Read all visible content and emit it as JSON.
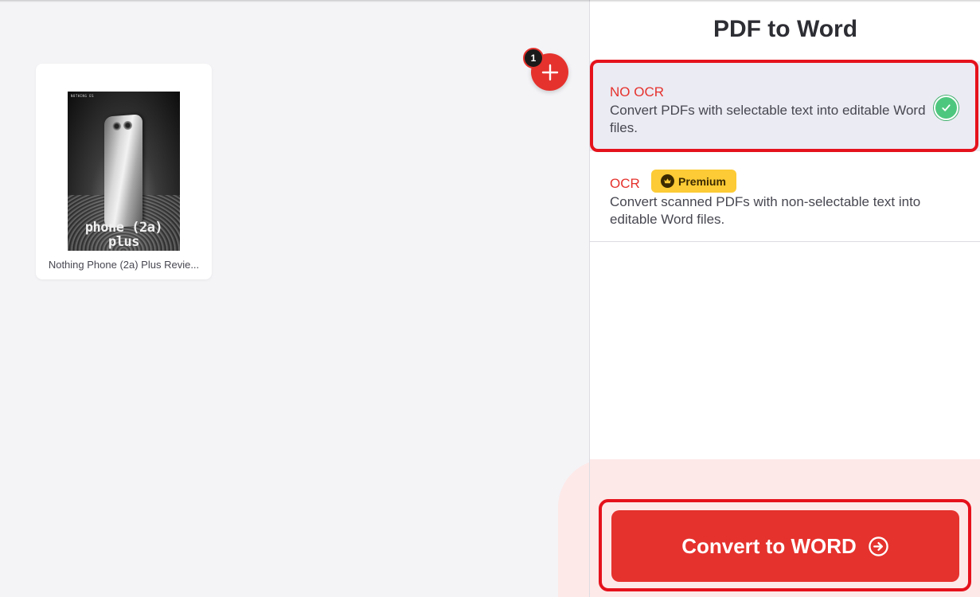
{
  "workspace": {
    "files": [
      {
        "name": "Nothing Phone (2a) Plus Revie...",
        "thumbnail_caption": "phone (2a) plus",
        "thumbnail_header": "NOTHING ES"
      }
    ],
    "file_count": "1",
    "add_icon": "plus-icon"
  },
  "sidebar": {
    "title": "PDF to Word",
    "options": [
      {
        "id": "no-ocr",
        "title": "NO OCR",
        "description": "Convert PDFs with selectable text into editable Word files.",
        "selected": true,
        "icon": "check-icon"
      },
      {
        "id": "ocr",
        "title": "OCR",
        "badge": "Premium",
        "badge_icon": "crown-icon",
        "description": "Convert scanned PDFs with non-selectable text into editable Word files.",
        "selected": false
      }
    ],
    "action": {
      "label": "Convert to WORD",
      "icon": "arrow-right-circle-icon"
    }
  },
  "colors": {
    "accent": "#e5322d",
    "selected_bg": "#ebebf3",
    "success": "#4ec77e",
    "premium": "#fccb35",
    "action_bg": "#fde9e8",
    "highlight": "#e5121c"
  }
}
